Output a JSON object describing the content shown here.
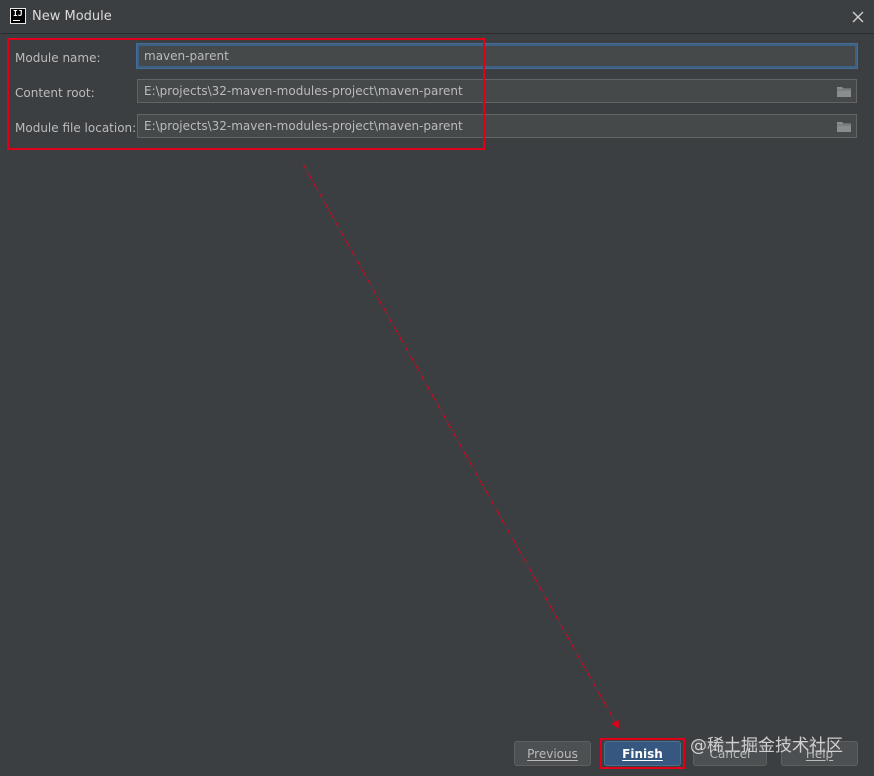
{
  "window": {
    "title": "New Module",
    "app_icon_text": "IJ"
  },
  "form": {
    "module_name_label": "Module name:",
    "module_name_value": "maven-parent",
    "content_root_label": "Content root:",
    "content_root_value": "E:\\projects\\32-maven-modules-project\\maven-parent",
    "module_file_location_label": "Module file location:",
    "module_file_location_value": "E:\\projects\\32-maven-modules-project\\maven-parent"
  },
  "buttons": {
    "previous": "Previous",
    "finish": "Finish",
    "cancel": "Cancel",
    "help": "Help"
  },
  "watermark": "@稀土掘金技术社区",
  "colors": {
    "background": "#3c3f41",
    "input_background": "#45494a",
    "accent": "#365880",
    "annotation": "#e0001a"
  },
  "icons": {
    "close": "close-icon",
    "folder": "folder-icon"
  }
}
